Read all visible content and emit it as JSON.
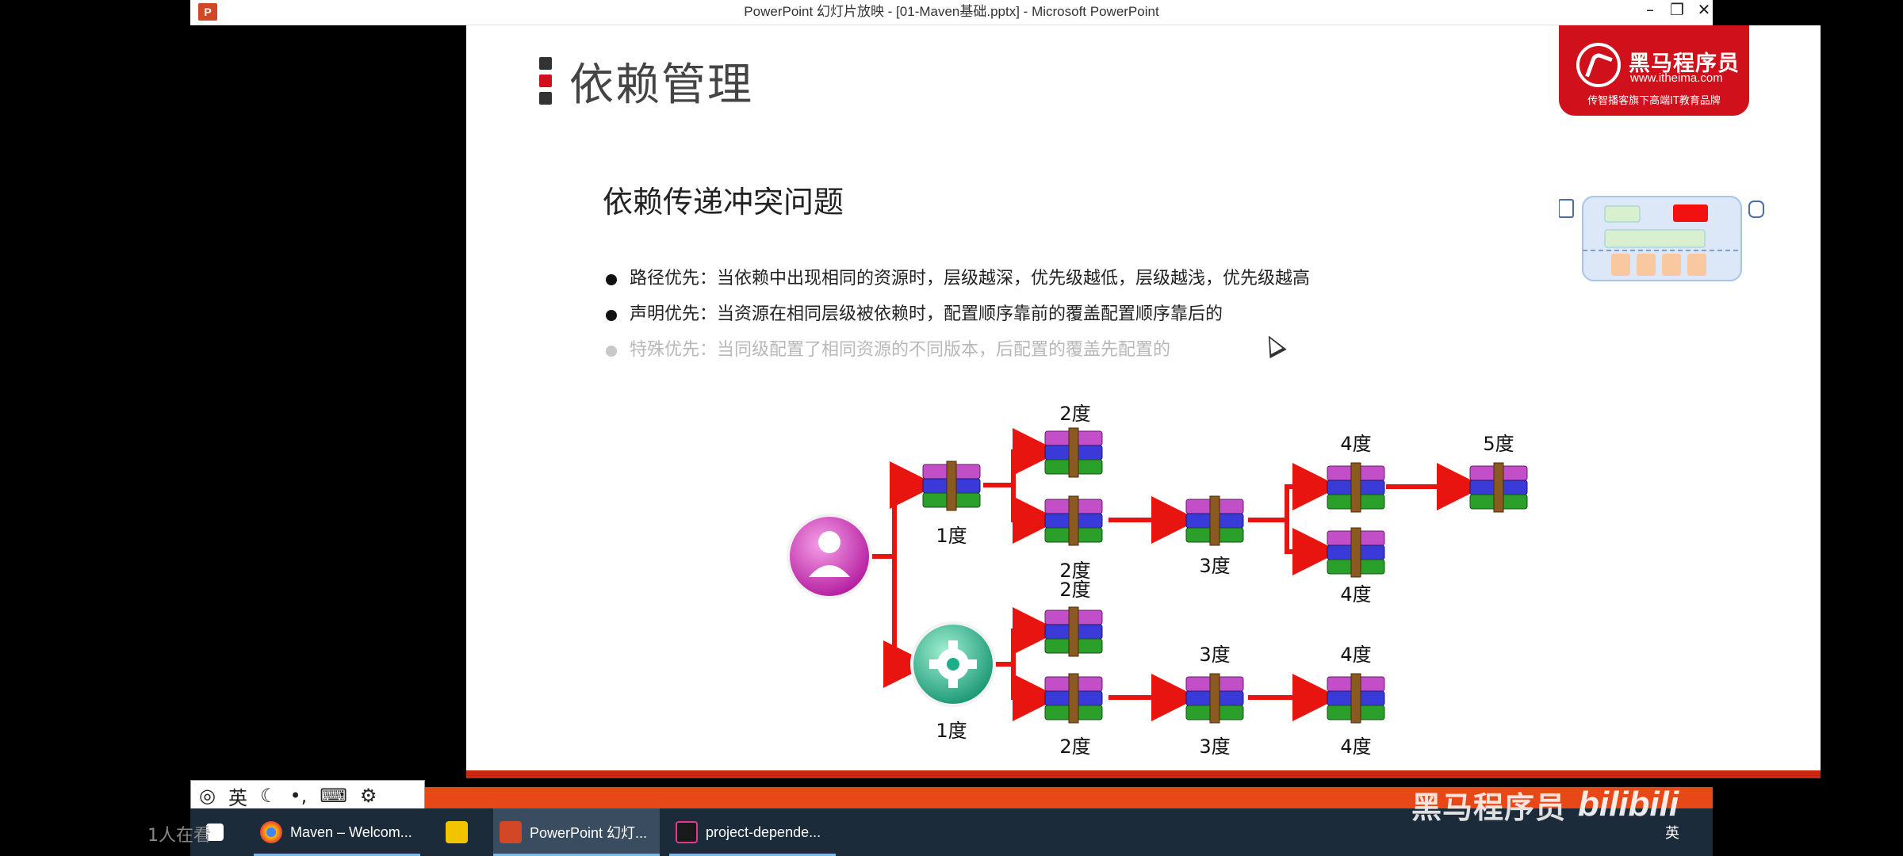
{
  "window": {
    "title": "PowerPoint 幻灯片放映 - [01-Maven基础.pptx] - Microsoft PowerPoint",
    "app_icon_letter": "P"
  },
  "slide": {
    "title": "依赖管理",
    "logo": {
      "name": "黑马程序员",
      "url": "www.itheima.com",
      "slogan": "传智播客旗下高端IT教育品牌"
    },
    "subtitle": "依赖传递冲突问题",
    "bullets": [
      "路径优先：当依赖中出现相同的资源时，层级越深，优先级越低，层级越浅，优先级越高",
      "声明优先：当资源在相同层级被依赖时，配置顺序靠前的覆盖配置顺序靠后的",
      "特殊优先：当同级配置了相同资源的不同版本，后配置的覆盖先配置的"
    ]
  },
  "diagram": {
    "labels": {
      "n1a": "1度",
      "n2a": "2度",
      "n2b": "2度",
      "n3a": "3度",
      "n4a": "4度",
      "n4b": "4度",
      "n5a": "5度",
      "n1b": "1度",
      "n2c": "2度",
      "n2d": "2度",
      "n3b": "3度",
      "n3c": "3度",
      "n4c": "4度",
      "n4d": "4度"
    },
    "colors": {
      "arrow": "#e8140f",
      "user_node": "#c21fae",
      "gear_node": "#1fae8a"
    }
  },
  "taskbar": {
    "items": [
      {
        "label": "Maven – Welcom..."
      },
      {
        "label": ""
      },
      {
        "label": "PowerPoint 幻灯..."
      },
      {
        "label": "project-depende..."
      }
    ],
    "ime_lang": "英",
    "tray_lang": "英"
  },
  "overlay": {
    "viewers": "1人在看",
    "watermark": "黑马程序员",
    "bili": "bilibili"
  }
}
